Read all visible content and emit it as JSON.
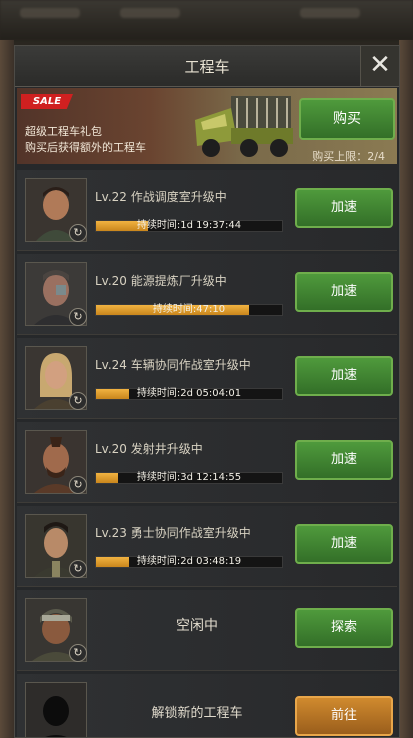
{
  "title": "工程车",
  "banner": {
    "sale_label": "SALE",
    "line1": "超级工程车礼包",
    "line2": "购买后获得额外的工程车",
    "buy_label": "购买",
    "limit": "购买上限：2/4"
  },
  "trucks": [
    {
      "task": "Lv.22 作战调度室升级中",
      "timer": "持续时间:1d 19:37:44",
      "progress": 0.28,
      "button": "加速"
    },
    {
      "task": "Lv.20 能源提炼厂升级中",
      "timer": "持续时间:47:10",
      "progress": 0.82,
      "button": "加速"
    },
    {
      "task": "Lv.24 车辆协同作战室升级中",
      "timer": "持续时间:2d 05:04:01",
      "progress": 0.18,
      "button": "加速"
    },
    {
      "task": "Lv.20 发射井升级中",
      "timer": "持续时间:3d 12:14:55",
      "progress": 0.12,
      "button": "加速"
    },
    {
      "task": "Lv.23 勇士协同作战室升级中",
      "timer": "持续时间:2d 03:48:19",
      "progress": 0.18,
      "button": "加速"
    }
  ],
  "idle_slot": {
    "status": "空闲中",
    "button": "探索"
  },
  "locked_slot": {
    "text": "解锁新的工程车",
    "button": "前往"
  },
  "colors": {
    "green_button": "#3f8a32",
    "progress_fill": "#e0a030",
    "sale_red": "#d02020",
    "orange_button": "#c27a28"
  }
}
